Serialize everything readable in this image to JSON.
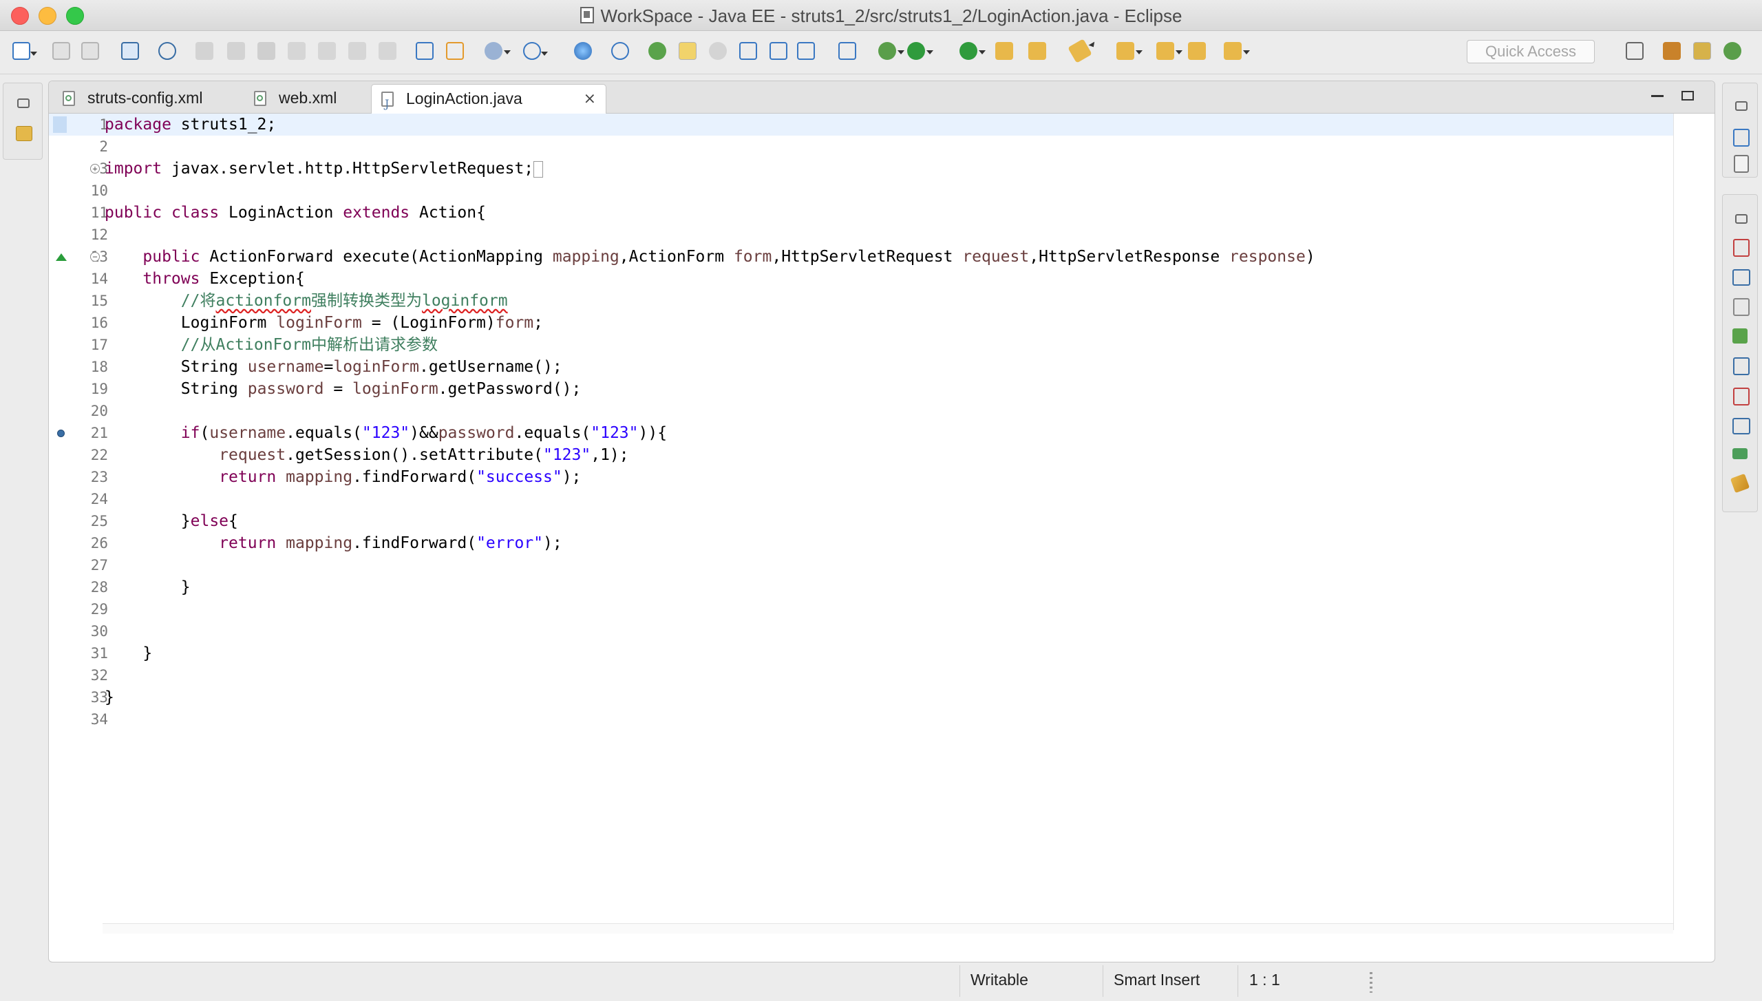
{
  "window": {
    "title": "WorkSpace - Java EE - struts1_2/src/struts1_2/LoginAction.java - Eclipse"
  },
  "toolbar": {
    "quick_access_placeholder": "Quick Access",
    "icons": [
      "new-icon",
      "save-icon",
      "save-all-icon",
      "display-icon",
      "skip-breakpoints-icon",
      "resume-icon",
      "suspend-icon",
      "terminate-icon",
      "disconnect-icon",
      "step-into-icon",
      "step-over-icon",
      "step-return-icon",
      "task-icon",
      "toggle-block-icon",
      "new-server-icon",
      "new-web-service-icon",
      "globe-icon",
      "refresh-icon",
      "new-java-class-icon",
      "mark-occurrences-icon",
      "toggle-breadcrumb-icon",
      "open-type-icon",
      "open-task-icon",
      "toggle-word-wrap-icon",
      "show-whitespace-icon",
      "debug-icon",
      "run-icon",
      "run-external-icon",
      "open-folder-icon",
      "open-folder-2-icon",
      "pin-icon",
      "next-annotation-icon",
      "previous-annotation-icon",
      "last-edit-icon",
      "back-icon",
      "forward-icon"
    ]
  },
  "editor": {
    "tabs": [
      {
        "label": "struts-config.xml",
        "type": "xml"
      },
      {
        "label": "web.xml",
        "type": "xml"
      },
      {
        "label": "LoginAction.java",
        "type": "java",
        "active": true
      }
    ],
    "close_glyph": "⨯",
    "lines": [
      {
        "n": "1",
        "html": "<span class=\"kw\">package</span> struts1_2;"
      },
      {
        "n": "2",
        "html": ""
      },
      {
        "n": "3",
        "html": "<span class=\"kw\">import</span> javax.servlet.http.HttpServletRequest;<span class=\"collapsed-box\"></span>"
      },
      {
        "n": "10",
        "html": ""
      },
      {
        "n": "11",
        "html": "<span class=\"kw\">public</span> <span class=\"kw\">class</span> LoginAction <span class=\"kw\">extends</span> Action{"
      },
      {
        "n": "12",
        "html": ""
      },
      {
        "n": "13",
        "html": "    <span class=\"kw\">public</span> ActionForward execute(ActionMapping <span class=\"fld\">mapping</span>,ActionForm <span class=\"fld\">form</span>,HttpServletRequest <span class=\"fld\">request</span>,HttpServletResponse <span class=\"fld\">response</span>)"
      },
      {
        "n": "14",
        "html": "    <span class=\"kw\">throws</span> Exception{"
      },
      {
        "n": "15",
        "html": "        <span class=\"cmt\">//将<span class=\"squiggle\">actionform</span>强制转换类型为<span class=\"squiggle\">loginform</span></span>"
      },
      {
        "n": "16",
        "html": "        LoginForm <span class=\"fld\">loginForm</span> = (LoginForm)<span class=\"fld\">form</span>;"
      },
      {
        "n": "17",
        "html": "        <span class=\"cmt\">//从ActionForm中解析出请求参数</span>"
      },
      {
        "n": "18",
        "html": "        String <span class=\"fld\">username</span>=<span class=\"fld\">loginForm</span>.getUsername();"
      },
      {
        "n": "19",
        "html": "        String <span class=\"fld\">password</span> = <span class=\"fld\">loginForm</span>.getPassword();"
      },
      {
        "n": "20",
        "html": ""
      },
      {
        "n": "21",
        "html": "        <span class=\"kw\">if</span>(<span class=\"fld\">username</span>.equals(<span class=\"str\">\"123\"</span>)&amp;&amp;<span class=\"fld\">password</span>.equals(<span class=\"str\">\"123\"</span>)){"
      },
      {
        "n": "22",
        "html": "            <span class=\"fld\">request</span>.getSession().setAttribute(<span class=\"str\">\"123\"</span>,1);"
      },
      {
        "n": "23",
        "html": "            <span class=\"kw\">return</span> <span class=\"fld\">mapping</span>.findForward(<span class=\"str\">\"success\"</span>);"
      },
      {
        "n": "24",
        "html": ""
      },
      {
        "n": "25",
        "html": "        }<span class=\"kw\">else</span>{"
      },
      {
        "n": "26",
        "html": "            <span class=\"kw\">return</span> <span class=\"fld\">mapping</span>.findForward(<span class=\"str\">\"error\"</span>);"
      },
      {
        "n": "27",
        "html": ""
      },
      {
        "n": "28",
        "html": "        }"
      },
      {
        "n": "29",
        "html": ""
      },
      {
        "n": "30",
        "html": ""
      },
      {
        "n": "31",
        "html": "    }"
      },
      {
        "n": "32",
        "html": ""
      },
      {
        "n": "33",
        "html": "}"
      },
      {
        "n": "34",
        "html": ""
      }
    ]
  },
  "statusbar": {
    "writable": "Writable",
    "insert_mode": "Smart Insert",
    "cursor_position": "1 : 1"
  },
  "colors": {
    "keyword": "#7f0055",
    "field": "#6a3e3e",
    "string": "#2a00ff",
    "comment": "#3f7f5f",
    "current_line": "#e8f2fe"
  }
}
